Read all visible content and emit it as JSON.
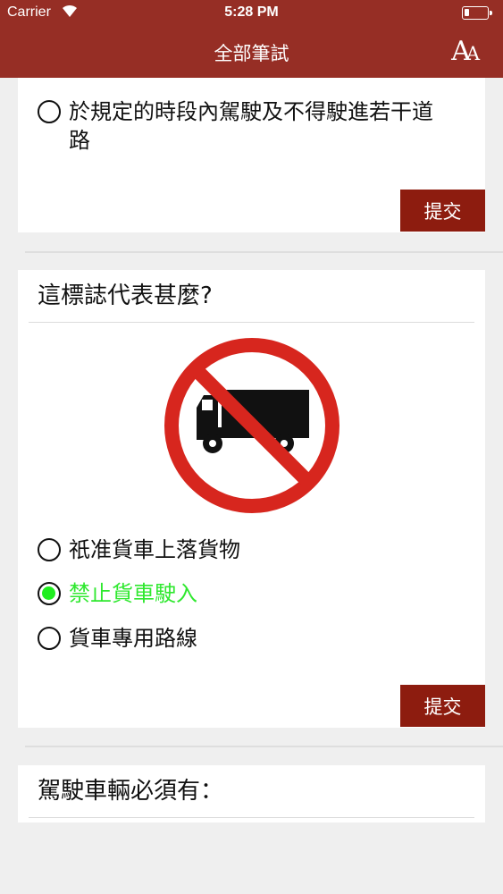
{
  "status_bar": {
    "carrier": "Carrier",
    "time": "5:28 PM"
  },
  "nav": {
    "title": "全部筆試",
    "font_size_button": {
      "big": "A",
      "small": "A"
    }
  },
  "questions": [
    {
      "options": [
        {
          "label": "於規定的時段內駕駛及不得駛進若干道路",
          "selected": false
        }
      ],
      "submit_label": "提交"
    },
    {
      "title": "這標誌代表甚麼?",
      "image": "no-goods-vehicles-sign",
      "options": [
        {
          "label": "祇准貨車上落貨物",
          "selected": false
        },
        {
          "label": "禁止貨車駛入",
          "selected": true
        },
        {
          "label": "貨車專用路線",
          "selected": false
        }
      ],
      "submit_label": "提交"
    },
    {
      "title": "駕駛車輛必須有："
    }
  ],
  "colors": {
    "header": "#962e25",
    "submit_button": "#8d1c0f",
    "selected_answer": "#2fe82f",
    "sign_red": "#d7261e"
  }
}
